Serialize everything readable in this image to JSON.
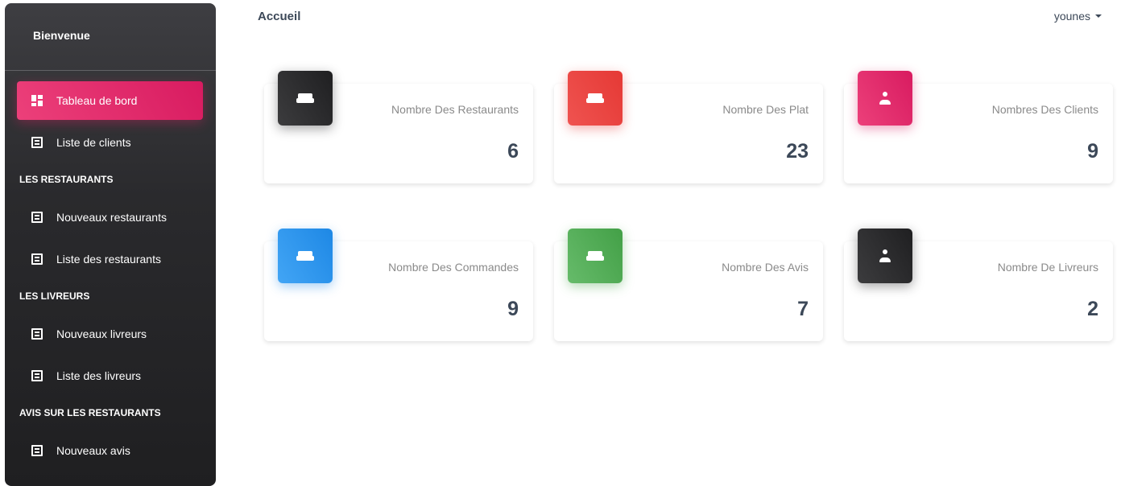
{
  "sidebar": {
    "brand": "Bienvenue",
    "items": [
      {
        "label": "Tableau de bord",
        "icon": "dashboard-icon",
        "active": true
      },
      {
        "label": "Liste de clients",
        "icon": "receipt-icon"
      }
    ],
    "sections": [
      {
        "title": "LES RESTAURANTS",
        "items": [
          {
            "label": "Nouveaux restaurants",
            "icon": "receipt-icon"
          },
          {
            "label": "Liste des restaurants",
            "icon": "receipt-icon"
          }
        ]
      },
      {
        "title": "LES LIVREURS",
        "items": [
          {
            "label": "Nouveaux livreurs",
            "icon": "receipt-icon"
          },
          {
            "label": "Liste des livreurs",
            "icon": "receipt-icon"
          }
        ]
      },
      {
        "title": "AVIS SUR LES RESTAURANTS",
        "items": [
          {
            "label": "Nouveaux avis",
            "icon": "receipt-icon"
          }
        ]
      }
    ]
  },
  "header": {
    "title": "Accueil",
    "user": "younes"
  },
  "stats": [
    {
      "label": "Nombre Des Restaurants",
      "value": "6",
      "icon": "sofa-icon",
      "color_from": "#3c3c3e",
      "color_to": "#1f1f21"
    },
    {
      "label": "Nombre Des Plat",
      "value": "23",
      "icon": "sofa-icon",
      "color_from": "#ef5350",
      "color_to": "#e53935"
    },
    {
      "label": "Nombres Des Clients",
      "value": "9",
      "icon": "person-icon",
      "color_from": "#ec407a",
      "color_to": "#d81b60"
    },
    {
      "label": "Nombre Des Commandes",
      "value": "9",
      "icon": "sofa-icon",
      "color_from": "#42a5f5",
      "color_to": "#1e88e5"
    },
    {
      "label": "Nombre Des Avis",
      "value": "7",
      "icon": "sofa-icon",
      "color_from": "#66bb6a",
      "color_to": "#43a047"
    },
    {
      "label": "Nombre De Livreurs",
      "value": "2",
      "icon": "person-icon",
      "color_from": "#3c3c3e",
      "color_to": "#1f1f21"
    }
  ]
}
